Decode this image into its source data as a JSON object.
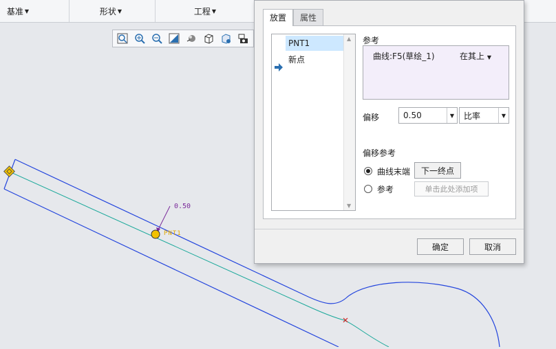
{
  "ribbon": {
    "groups": [
      {
        "label": "基准"
      },
      {
        "label": "形状"
      },
      {
        "label": "工程"
      }
    ]
  },
  "view_toolbar": {
    "icons": [
      "refit-icon",
      "zoom-in-icon",
      "zoom-out-icon",
      "repaint-icon",
      "display-style-icon",
      "saved-orientation-icon",
      "view-manager-icon",
      "camera-icon"
    ]
  },
  "canvas": {
    "dimension_value": "0.50",
    "point_label": "PNT1",
    "colors": {
      "sketch": "#2244dd",
      "curve": "#1aa89a",
      "point": "#f2c200",
      "dimension": "#7a2a9a"
    }
  },
  "dialog": {
    "tabs": [
      {
        "label": "放置"
      },
      {
        "label": "属性"
      }
    ],
    "list": {
      "items": [
        {
          "label": "PNT1"
        },
        {
          "label": "新点"
        }
      ]
    },
    "reference": {
      "label": "参考",
      "item": "曲线:F5(草绘_1)",
      "constraint": "在其上"
    },
    "offset": {
      "label": "偏移",
      "value": "0.50",
      "type": "比率"
    },
    "offset_reference": {
      "label": "偏移参考",
      "option1": "曲线末端",
      "option1_button": "下一终点",
      "option2": "参考",
      "option2_button": "单击此处添加项"
    },
    "buttons": {
      "ok": "确定",
      "cancel": "取消"
    }
  }
}
